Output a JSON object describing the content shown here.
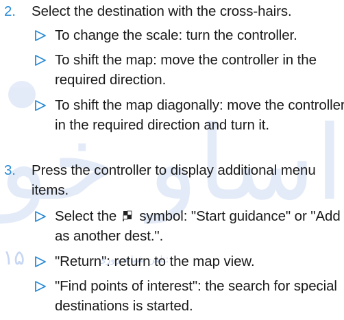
{
  "colors": {
    "accent": "#2a8bd6",
    "text": "#1a1a1a",
    "watermark": "#3b6fd1"
  },
  "watermark": {
    "big_text": "اساو خو",
    "number": "۱۵",
    "small_text": "تلفن شبانه روزی:"
  },
  "steps": [
    {
      "num": "2.",
      "text": "Select the destination with the cross-hairs.",
      "bullets": [
        {
          "text": "To change the scale: turn the controller."
        },
        {
          "text": "To shift the map: move the controller in the required direction."
        },
        {
          "text": "To shift the map diagonally: move the controller in the required direction and turn it."
        }
      ]
    },
    {
      "num": "3.",
      "text": "Press the controller to display additional menu items.",
      "bullets": [
        {
          "text_before": "Select the",
          "icon": "flag-symbol-icon",
          "text_after": "symbol: \"Start guidance\" or \"Add as another dest.\"."
        },
        {
          "text": "\"Return\": return to the map view."
        },
        {
          "text": "\"Find points of interest\": the search for special destinations is started."
        }
      ]
    }
  ]
}
